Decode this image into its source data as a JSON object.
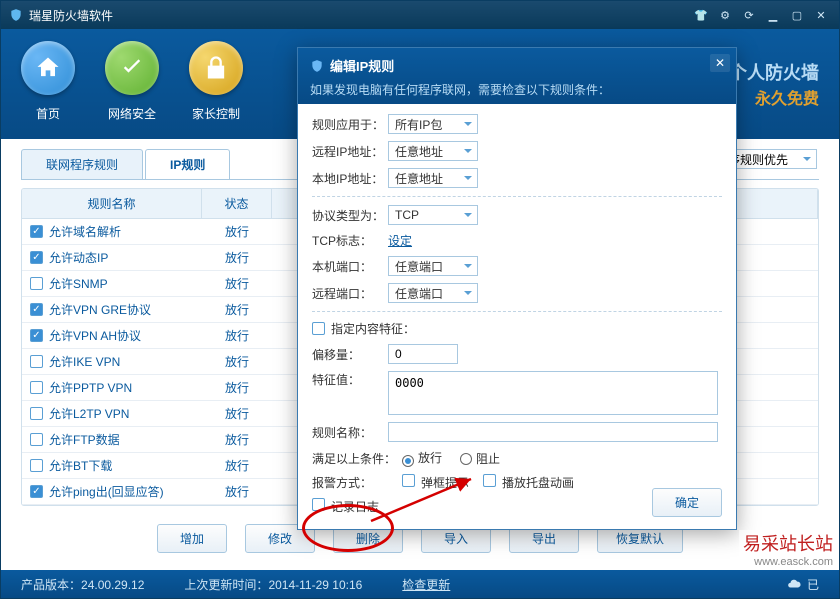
{
  "window": {
    "title": "瑞星防火墙软件"
  },
  "titlebar_icons": [
    "shirt",
    "gear",
    "refresh",
    "min",
    "max",
    "close"
  ],
  "brand": {
    "line1": "瑞星个人防火墙",
    "line2": "永久免费"
  },
  "nav": [
    {
      "label": "首页",
      "icon": "home"
    },
    {
      "label": "网络安全",
      "icon": "check"
    },
    {
      "label": "家长控制",
      "icon": "lock"
    }
  ],
  "tabs": [
    {
      "label": "联网程序规则",
      "active": false
    },
    {
      "label": "IP规则",
      "active": true
    }
  ],
  "right_select": "序规则优先",
  "columns": {
    "name": "规则名称",
    "state": "状态",
    "range": ""
  },
  "rows": [
    {
      "checked": true,
      "name": "允许域名解析",
      "state": "放行"
    },
    {
      "checked": true,
      "name": "允许动态IP",
      "state": "放行"
    },
    {
      "checked": false,
      "name": "允许SNMP",
      "state": "放行"
    },
    {
      "checked": true,
      "name": "允许VPN GRE协议",
      "state": "放行"
    },
    {
      "checked": true,
      "name": "允许VPN AH协议",
      "state": "放行"
    },
    {
      "checked": false,
      "name": "允许IKE VPN",
      "state": "放行"
    },
    {
      "checked": false,
      "name": "允许PPTP VPN",
      "state": "放行"
    },
    {
      "checked": false,
      "name": "允许L2TP VPN",
      "state": "放行"
    },
    {
      "checked": false,
      "name": "允许FTP数据",
      "state": "放行"
    },
    {
      "checked": false,
      "name": "允许BT下载",
      "state": "放行"
    },
    {
      "checked": true,
      "name": "允许ping出(回显应答)",
      "state": "放行"
    }
  ],
  "buttons": {
    "add": "增加",
    "edit": "修改",
    "del": "删除",
    "import": "导入",
    "export": "导出",
    "reset": "恢复默认"
  },
  "status": {
    "version_label": "产品版本：",
    "version": "24.00.29.12",
    "update_label": "上次更新时间：",
    "update": "2014-11-29 10:16",
    "check": "检查更新",
    "logged": "已"
  },
  "dialog": {
    "title": "编辑IP规则",
    "subtitle": "如果发现电脑有任何程序联网，需要检查以下规则条件：",
    "apply_label": "规则应用于：",
    "apply_value": "所有IP包",
    "remote_ip_label": "远程IP地址：",
    "remote_ip_value": "任意地址",
    "local_ip_label": "本地IP地址：",
    "local_ip_value": "任意地址",
    "proto_label": "协议类型为：",
    "proto_value": "TCP",
    "tcp_flag_label": "TCP标志：",
    "tcp_flag_link": "设定",
    "local_port_label": "本机端口：",
    "local_port_value": "任意端口",
    "remote_port_label": "远程端口：",
    "remote_port_value": "任意端口",
    "content_chk": "指定内容特征：",
    "offset_label": "偏移量：",
    "offset_value": "0",
    "feature_label": "特征值：",
    "feature_value": "0000",
    "rule_name_label": "规则名称：",
    "rule_name_value": "",
    "cond_label": "满足以上条件：",
    "cond_allow": "放行",
    "cond_block": "阻止",
    "alert_label": "报警方式：",
    "alert_popup": "弹框提示",
    "alert_tray": "播放托盘动画",
    "log_chk": "记录日志",
    "ok": "确定"
  },
  "watermark": {
    "cn": "易采站长站",
    "en": "www.easck.com"
  }
}
